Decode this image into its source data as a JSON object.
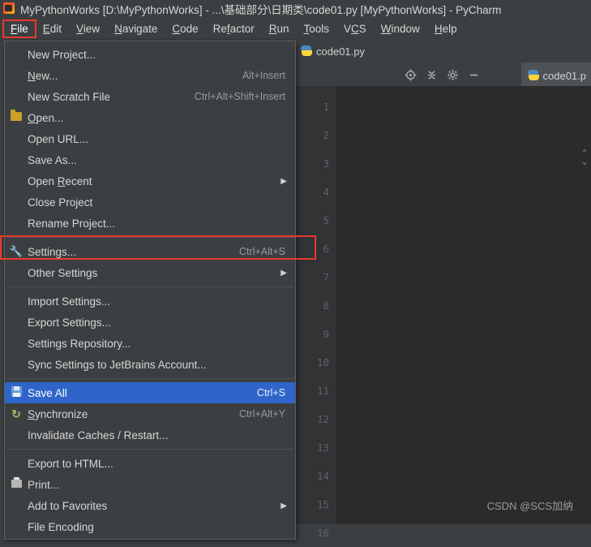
{
  "window": {
    "title": "MyPythonWorks [D:\\MyPythonWorks] - ...\\基础部分\\日期类\\code01.py [MyPythonWorks] - PyCharm",
    "app_icon": "pycharm-icon"
  },
  "menubar": {
    "items": [
      {
        "label": "File",
        "active": true
      },
      {
        "label": "Edit",
        "active": false
      },
      {
        "label": "View",
        "active": false
      },
      {
        "label": "Navigate",
        "active": false
      },
      {
        "label": "Code",
        "active": false
      },
      {
        "label": "Refactor",
        "active": false
      },
      {
        "label": "Run",
        "active": false
      },
      {
        "label": "Tools",
        "active": false
      },
      {
        "label": "VCS",
        "active": false
      },
      {
        "label": "Window",
        "active": false
      },
      {
        "label": "Help",
        "active": false
      }
    ]
  },
  "file_menu": {
    "items": [
      {
        "label": "New Project...",
        "accel": "",
        "icon": "",
        "submenu": false,
        "selected": false,
        "highlighted": false
      },
      {
        "label": "New...",
        "accel": "Alt+Insert",
        "icon": "",
        "submenu": false,
        "selected": false,
        "highlighted": false
      },
      {
        "label": "New Scratch File",
        "accel": "Ctrl+Alt+Shift+Insert",
        "icon": "",
        "submenu": false,
        "selected": false,
        "highlighted": false
      },
      {
        "label": "Open...",
        "accel": "",
        "icon": "folder-icon",
        "submenu": false,
        "selected": false,
        "highlighted": false
      },
      {
        "label": "Open URL...",
        "accel": "",
        "icon": "",
        "submenu": false,
        "selected": false,
        "highlighted": false
      },
      {
        "label": "Save As...",
        "accel": "",
        "icon": "",
        "submenu": false,
        "selected": false,
        "highlighted": false
      },
      {
        "label": "Open Recent",
        "accel": "",
        "icon": "",
        "submenu": true,
        "selected": false,
        "highlighted": false
      },
      {
        "label": "Close Project",
        "accel": "",
        "icon": "",
        "submenu": false,
        "selected": false,
        "highlighted": false
      },
      {
        "label": "Rename Project...",
        "accel": "",
        "icon": "",
        "submenu": false,
        "selected": false,
        "highlighted": false
      },
      {
        "label": "separator"
      },
      {
        "label": "Settings...",
        "accel": "Ctrl+Alt+S",
        "icon": "wrench-icon",
        "submenu": false,
        "selected": false,
        "highlighted": true
      },
      {
        "label": "Other Settings",
        "accel": "",
        "icon": "",
        "submenu": true,
        "selected": false,
        "highlighted": false
      },
      {
        "label": "separator"
      },
      {
        "label": "Import Settings...",
        "accel": "",
        "icon": "",
        "submenu": false,
        "selected": false,
        "highlighted": false
      },
      {
        "label": "Export Settings...",
        "accel": "",
        "icon": "",
        "submenu": false,
        "selected": false,
        "highlighted": false
      },
      {
        "label": "Settings Repository...",
        "accel": "",
        "icon": "",
        "submenu": false,
        "selected": false,
        "highlighted": false
      },
      {
        "label": "Sync Settings to JetBrains Account...",
        "accel": "",
        "icon": "",
        "submenu": false,
        "selected": false,
        "highlighted": false
      },
      {
        "label": "separator"
      },
      {
        "label": "Save All",
        "accel": "Ctrl+S",
        "icon": "save-icon",
        "submenu": false,
        "selected": true,
        "highlighted": false
      },
      {
        "label": "Synchronize",
        "accel": "Ctrl+Alt+Y",
        "icon": "sync-icon",
        "submenu": false,
        "selected": false,
        "highlighted": false
      },
      {
        "label": "Invalidate Caches / Restart...",
        "accel": "",
        "icon": "",
        "submenu": false,
        "selected": false,
        "highlighted": false
      },
      {
        "label": "separator"
      },
      {
        "label": "Export to HTML...",
        "accel": "",
        "icon": "",
        "submenu": false,
        "selected": false,
        "highlighted": false
      },
      {
        "label": "Print...",
        "accel": "",
        "icon": "print-icon",
        "submenu": false,
        "selected": false,
        "highlighted": false
      },
      {
        "label": "Add to Favorites",
        "accel": "",
        "icon": "",
        "submenu": true,
        "selected": false,
        "highlighted": false
      },
      {
        "label": "File Encoding",
        "accel": "",
        "icon": "",
        "submenu": false,
        "selected": false,
        "highlighted": false
      }
    ]
  },
  "editor": {
    "tab_background": {
      "label": "code01.py",
      "icon": "python-file-icon"
    },
    "tab_active": {
      "label": "code01.p",
      "icon": "python-file-icon"
    },
    "toolbar_icons": [
      "locate-icon",
      "collapse-all-icon",
      "settings-gear-icon",
      "hide-icon"
    ],
    "line_numbers": [
      "1",
      "2",
      "3",
      "4",
      "5",
      "6",
      "7",
      "8",
      "9",
      "10",
      "11",
      "12",
      "13",
      "14",
      "15",
      "16"
    ]
  },
  "watermark": {
    "text": "CSDN @SCS加纳"
  },
  "colors": {
    "accent_red": "#e8392f",
    "selection_blue": "#2f65ca",
    "panel_bg": "#3c3f41",
    "editor_bg": "#2b2b2b",
    "gutter_bg": "#313335",
    "text": "#d6d6d6"
  }
}
